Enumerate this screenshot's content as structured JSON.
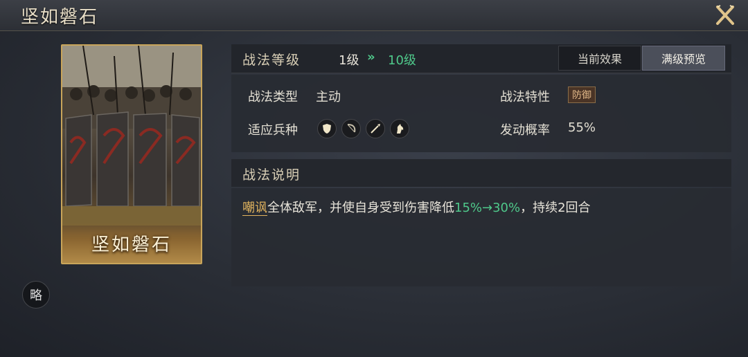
{
  "header": {
    "title": "坚如磐石"
  },
  "card": {
    "name": "坚如磐石"
  },
  "side_button": {
    "label": "略"
  },
  "level": {
    "label": "战法等级",
    "current": "1级",
    "arrow": "»",
    "max": "10级"
  },
  "tabs": [
    {
      "label": "当前效果",
      "active": false
    },
    {
      "label": "满级预览",
      "active": true
    }
  ],
  "info": {
    "type_label": "战法类型",
    "type_value": "主动",
    "trait_label": "战法特性",
    "trait_value": "防御",
    "troops_label": "适应兵种",
    "troops_icons": [
      "shield-icon",
      "bow-icon",
      "spear-icon",
      "horse-icon"
    ],
    "rate_label": "发动概率",
    "rate_value": "55%"
  },
  "description": {
    "heading": "战法说明",
    "keyword": "嘲讽",
    "text_before": "全体敌军，并使自身受到伤害降低",
    "values": "15%→30%",
    "text_after": "，持续2回合"
  },
  "colors": {
    "accent_green": "#4fc98b",
    "keyword_gold": "#e2b45e",
    "card_border": "#c9a55a"
  }
}
